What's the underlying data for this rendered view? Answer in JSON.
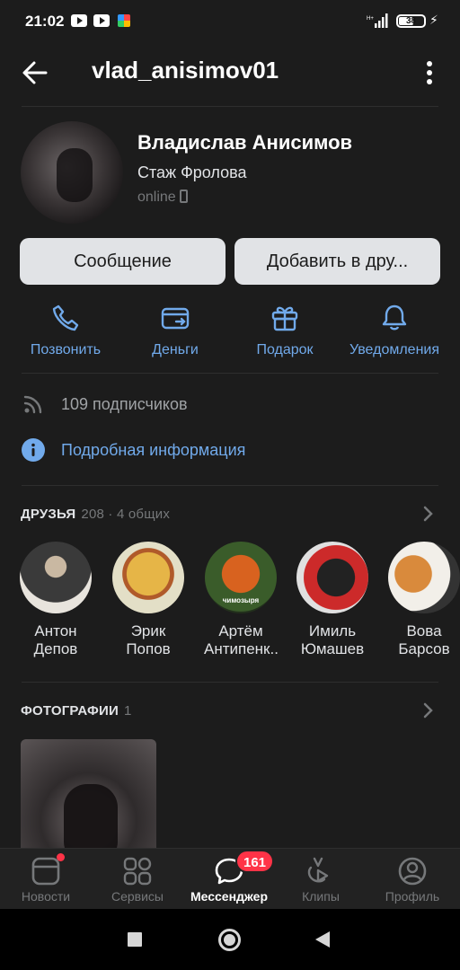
{
  "status_bar": {
    "time": "21:02",
    "battery": "38",
    "network": "H+"
  },
  "header": {
    "title": "vlad_anisimov01"
  },
  "profile": {
    "name": "Владислав Анисимов",
    "status": "Стаж Фролова",
    "online": "online"
  },
  "buttons": {
    "message": "Сообщение",
    "add_friend": "Добавить в дру..."
  },
  "actions": [
    {
      "label": "Позвонить",
      "icon": "phone-icon"
    },
    {
      "label": "Деньги",
      "icon": "wallet-icon"
    },
    {
      "label": "Подарок",
      "icon": "gift-icon"
    },
    {
      "label": "Уведомления",
      "icon": "bell-icon"
    }
  ],
  "info": {
    "subscribers": "109 подписчиков",
    "details": "Подробная информация"
  },
  "friends": {
    "title": "ДРУЗЬЯ",
    "meta": "208 · 4 общих",
    "items": [
      {
        "name": "Антон\nДепов"
      },
      {
        "name": "Эрик\nПопов"
      },
      {
        "name": "Артём\nАнтипенк...",
        "avatar_text": "чимозыря"
      },
      {
        "name": "Имиль\nЮмашев"
      },
      {
        "name": "Вова\nБарсов"
      }
    ]
  },
  "photos": {
    "title": "ФОТОГРАФИИ",
    "count": "1"
  },
  "tabbar": {
    "items": [
      {
        "label": "Новости",
        "icon": "news-icon"
      },
      {
        "label": "Сервисы",
        "icon": "services-icon"
      },
      {
        "label": "Мессенджер",
        "icon": "messenger-icon",
        "badge": "161"
      },
      {
        "label": "Клипы",
        "icon": "clips-icon"
      },
      {
        "label": "Профиль",
        "icon": "profile-icon"
      }
    ]
  },
  "colors": {
    "accent": "#71aaeb",
    "background": "#1c1c1c",
    "badge": "#ff3347",
    "button": "#e1e3e6"
  }
}
